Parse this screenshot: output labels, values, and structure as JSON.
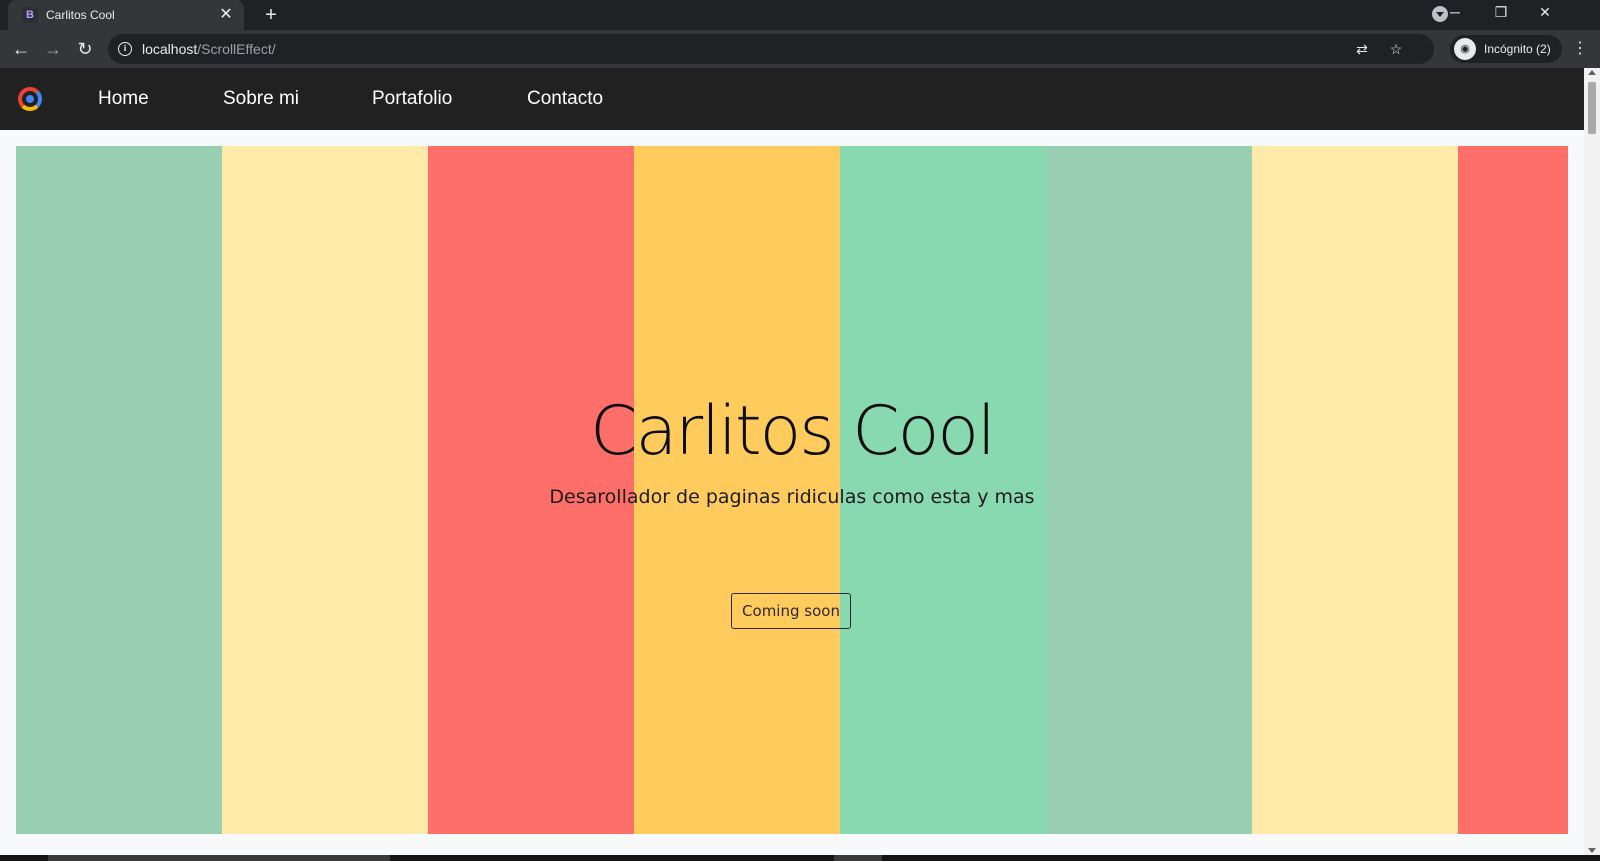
{
  "browser": {
    "tab": {
      "favicon": "B",
      "title": "Carlitos Cool",
      "close_icon": "✕"
    },
    "new_tab_icon": "+",
    "window_controls": {
      "minimize": "─",
      "restore": "❐",
      "close": "✕"
    },
    "nav": {
      "back_icon": "←",
      "forward_icon": "→",
      "reload_icon": "↻"
    },
    "address": {
      "host": "localhost",
      "path": "/ScrollEffect/",
      "info_icon": "i"
    },
    "translate_icon": "⇄",
    "bookmark_icon": "☆",
    "incognito_label": "Incógnito (2)",
    "incognito_icon": "◉",
    "menu_icon": "⋮"
  },
  "site": {
    "nav_links": [
      "Home",
      "Sobre mi",
      "Portafolio",
      "Contacto"
    ],
    "hero": {
      "title": "Carlitos Cool",
      "subtitle": "Desarollador de paginas ridiculas como esta y mas",
      "button": "Coming soon"
    },
    "stripe_colors": [
      "#98ceb2",
      "#ffeaaa",
      "#ff6f69",
      "#ffcb5c",
      "#88d8b0",
      "#98ceb2",
      "#ffeaaa",
      "#ff6f69"
    ]
  }
}
